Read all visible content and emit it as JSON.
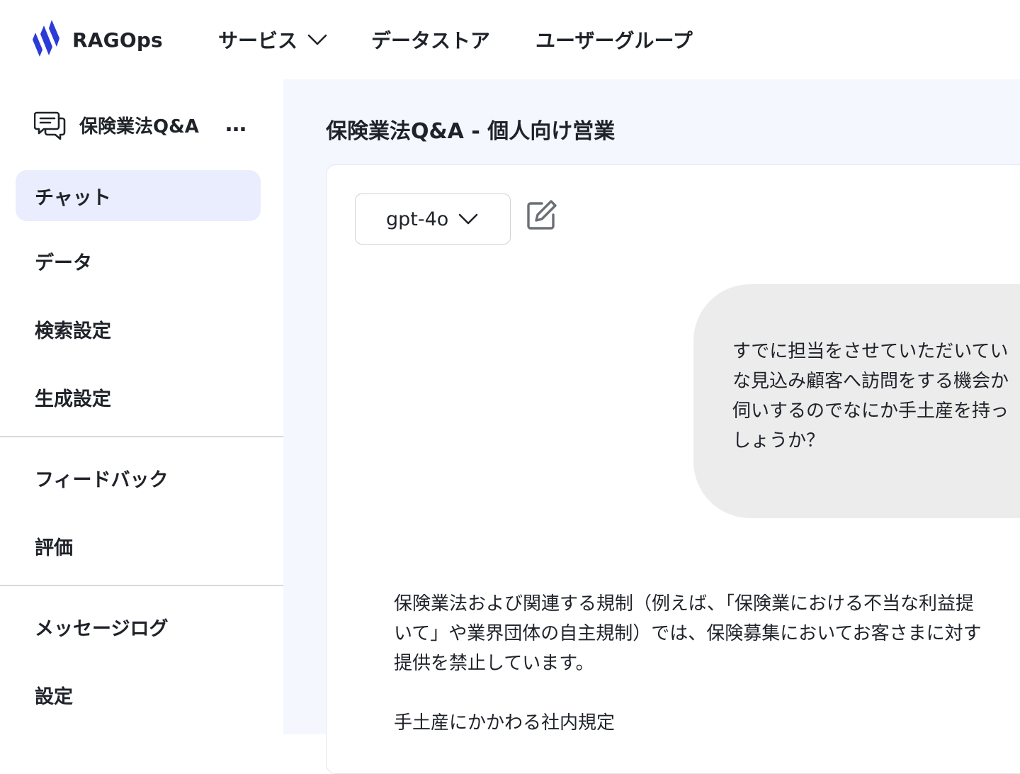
{
  "app": {
    "brand": "RAGOps",
    "brand_color": "#2b3bd6"
  },
  "nav": {
    "services": "サービス",
    "datastore": "データストア",
    "usergroup": "ユーザーグループ"
  },
  "sidebar": {
    "project_name": "保険業法Q&A",
    "more": "…",
    "items": [
      {
        "label": "チャット",
        "active": true
      },
      {
        "label": "データ"
      },
      {
        "label": "検索設定"
      },
      {
        "label": "生成設定"
      },
      {
        "label": "フィードバック"
      },
      {
        "label": "評価"
      },
      {
        "label": "メッセージログ"
      },
      {
        "label": "設定"
      }
    ]
  },
  "main": {
    "title": "保険業法Q&A - 個人向け営業",
    "model": "gpt-4o",
    "user_message": [
      "すでに担当をさせていただいてい",
      "な見込み顧客へ訪問をする機会か",
      "伺いするのでなにか手土産を持っ",
      "しょうか？"
    ],
    "answer": [
      "保険業法および関連する規制（例えば、「保険業における不当な利益提",
      "いて」や業界団体の自主規制）では、保険募集においてお客さまに対す",
      "提供を禁止しています。",
      "",
      "手土産にかかわる社内規定"
    ]
  }
}
